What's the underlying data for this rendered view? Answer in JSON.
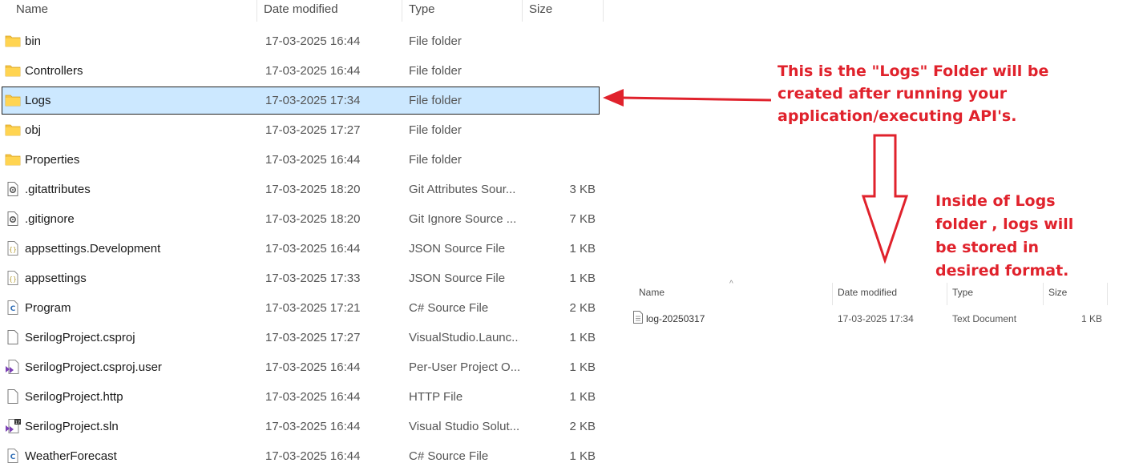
{
  "main": {
    "columns": {
      "name": "Name",
      "date": "Date modified",
      "type": "Type",
      "size": "Size"
    },
    "rows": [
      {
        "icon": "folder-icon",
        "name": "bin",
        "date": "17-03-2025 16:44",
        "type": "File folder",
        "size": ""
      },
      {
        "icon": "folder-icon",
        "name": "Controllers",
        "date": "17-03-2025 16:44",
        "type": "File folder",
        "size": ""
      },
      {
        "icon": "folder-icon",
        "name": "Logs",
        "date": "17-03-2025 17:34",
        "type": "File folder",
        "size": "",
        "selected": true
      },
      {
        "icon": "folder-icon",
        "name": "obj",
        "date": "17-03-2025 17:27",
        "type": "File folder",
        "size": ""
      },
      {
        "icon": "folder-icon",
        "name": "Properties",
        "date": "17-03-2025 16:44",
        "type": "File folder",
        "size": ""
      },
      {
        "icon": "settings-file-icon",
        "name": ".gitattributes",
        "date": "17-03-2025 18:20",
        "type": "Git Attributes Sour...",
        "size": "3 KB"
      },
      {
        "icon": "settings-file-icon",
        "name": ".gitignore",
        "date": "17-03-2025 18:20",
        "type": "Git Ignore Source ...",
        "size": "7 KB"
      },
      {
        "icon": "json-file-icon",
        "name": "appsettings.Development",
        "date": "17-03-2025 16:44",
        "type": "JSON Source File",
        "size": "1 KB"
      },
      {
        "icon": "json-file-icon",
        "name": "appsettings",
        "date": "17-03-2025 17:33",
        "type": "JSON Source File",
        "size": "1 KB"
      },
      {
        "icon": "csharp-file-icon",
        "name": "Program",
        "date": "17-03-2025 17:21",
        "type": "C# Source File",
        "size": "2 KB"
      },
      {
        "icon": "blank-file-icon",
        "name": "SerilogProject.csproj",
        "date": "17-03-2025 17:27",
        "type": "VisualStudio.Launc...",
        "size": "1 KB"
      },
      {
        "icon": "vs-user-file-icon",
        "name": "SerilogProject.csproj.user",
        "date": "17-03-2025 16:44",
        "type": "Per-User Project O...",
        "size": "1 KB"
      },
      {
        "icon": "blank-file-icon",
        "name": "SerilogProject.http",
        "date": "17-03-2025 16:44",
        "type": "HTTP File",
        "size": "1 KB"
      },
      {
        "icon": "vs-solution-icon",
        "name": "SerilogProject.sln",
        "date": "17-03-2025 16:44",
        "type": "Visual Studio Solut...",
        "size": "2 KB"
      },
      {
        "icon": "csharp-file-icon",
        "name": "WeatherForecast",
        "date": "17-03-2025 16:44",
        "type": "C# Source File",
        "size": "1 KB"
      }
    ]
  },
  "annotations": {
    "logs_folder": [
      "This is the \"Logs\" Folder will be",
      "created after running your",
      "application/executing API's."
    ],
    "inside_logs": [
      "Inside of Logs",
      "folder , logs will",
      "be stored in",
      "desired format."
    ],
    "color": "#e0222c"
  },
  "logs_view": {
    "columns": {
      "name": "Name",
      "date": "Date modified",
      "type": "Type",
      "size": "Size"
    },
    "sort_caret": "^",
    "rows": [
      {
        "icon": "text-file-icon",
        "name": "log-20250317",
        "date": "17-03-2025 17:34",
        "type": "Text Document",
        "size": "1 KB"
      }
    ]
  },
  "colors": {
    "selection": "#cce8ff",
    "folder": "#f5c342",
    "accent": "#e0222c"
  }
}
